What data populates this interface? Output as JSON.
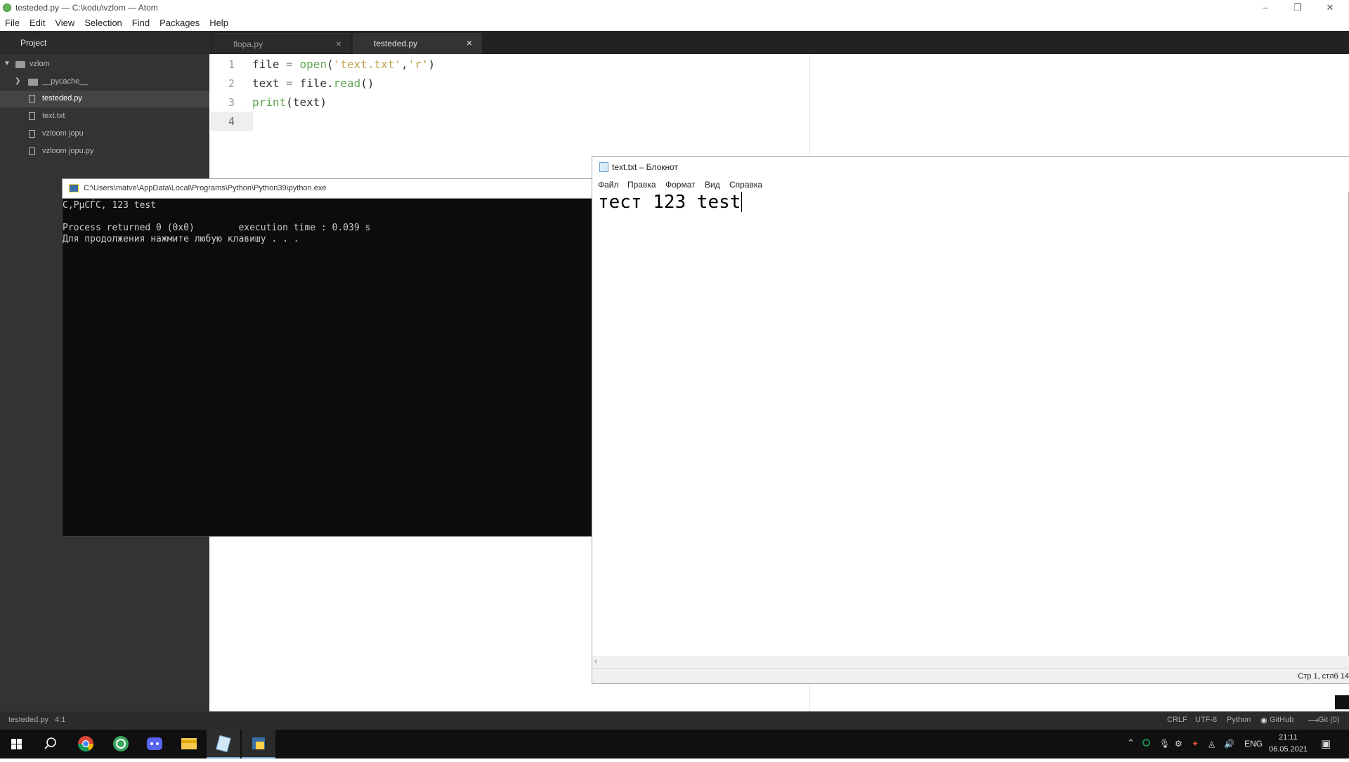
{
  "atom": {
    "window_title": "testeded.py — C:\\kodu\\vzlom — Atom",
    "menu": [
      "File",
      "Edit",
      "View",
      "Selection",
      "Find",
      "Packages",
      "Help"
    ],
    "panel_tab": "Project",
    "tabs": [
      {
        "label": "flopa.py",
        "active": false
      },
      {
        "label": "testeded.py",
        "active": true
      }
    ],
    "tree": {
      "root": "vzlom",
      "items": [
        {
          "label": "__pycache__",
          "type": "folder",
          "selected": false
        },
        {
          "label": "testeded.py",
          "type": "file",
          "selected": true
        },
        {
          "label": "text.txt",
          "type": "file",
          "selected": false
        },
        {
          "label": "vzloom jopu",
          "type": "file",
          "selected": false
        },
        {
          "label": "vzloom jopu.py",
          "type": "file",
          "selected": false
        }
      ]
    },
    "code_lines": [
      {
        "num": "1",
        "tokens": [
          {
            "t": "file ",
            "c": "#333333"
          },
          {
            "t": "= ",
            "c": "#999999"
          },
          {
            "t": "open",
            "c": "#5fa34f"
          },
          {
            "t": "(",
            "c": "#333333"
          },
          {
            "t": "'text.txt'",
            "c": "#c0a34a"
          },
          {
            "t": ",",
            "c": "#333333"
          },
          {
            "t": "'r'",
            "c": "#c0a34a"
          },
          {
            "t": ")",
            "c": "#333333"
          }
        ]
      },
      {
        "num": "2",
        "tokens": [
          {
            "t": "text ",
            "c": "#333333"
          },
          {
            "t": "= ",
            "c": "#999999"
          },
          {
            "t": "file.",
            "c": "#333333"
          },
          {
            "t": "read",
            "c": "#5fa34f"
          },
          {
            "t": "()",
            "c": "#333333"
          }
        ]
      },
      {
        "num": "3",
        "tokens": [
          {
            "t": "print",
            "c": "#5fa34f"
          },
          {
            "t": "(text)",
            "c": "#333333"
          }
        ]
      },
      {
        "num": "4",
        "tokens": []
      }
    ],
    "status": {
      "file": "testeded.py",
      "cursor": "4:1",
      "line_ending": "CRLF",
      "encoding": "UTF-8",
      "grammar": "Python",
      "github": "GitHub",
      "git": "Git (0)"
    }
  },
  "console": {
    "title": "C:\\Users\\matve\\AppData\\Local\\Programs\\Python\\Python39\\python.exe",
    "lines": [
      "С‚РµСЃС‚ 123 test",
      "",
      "Process returned 0 (0x0)        execution time : 0.039 s",
      "Для продолжения нажмите любую клавишу . . ."
    ]
  },
  "notepad": {
    "title": "text.txt – Блокнот",
    "menu": [
      "Файл",
      "Правка",
      "Формат",
      "Вид",
      "Справка"
    ],
    "content": "тест 123 test",
    "status": "Стр 1, стлб 14"
  },
  "taskbar": {
    "apps": [
      "windows-start-icon",
      "search-icon",
      "chrome-icon",
      "browser-icon",
      "discord-icon",
      "file-explorer-icon",
      "notepad-icon",
      "python-icon"
    ],
    "language": "ENG",
    "time": "21:11",
    "date": "06.05.2021"
  }
}
